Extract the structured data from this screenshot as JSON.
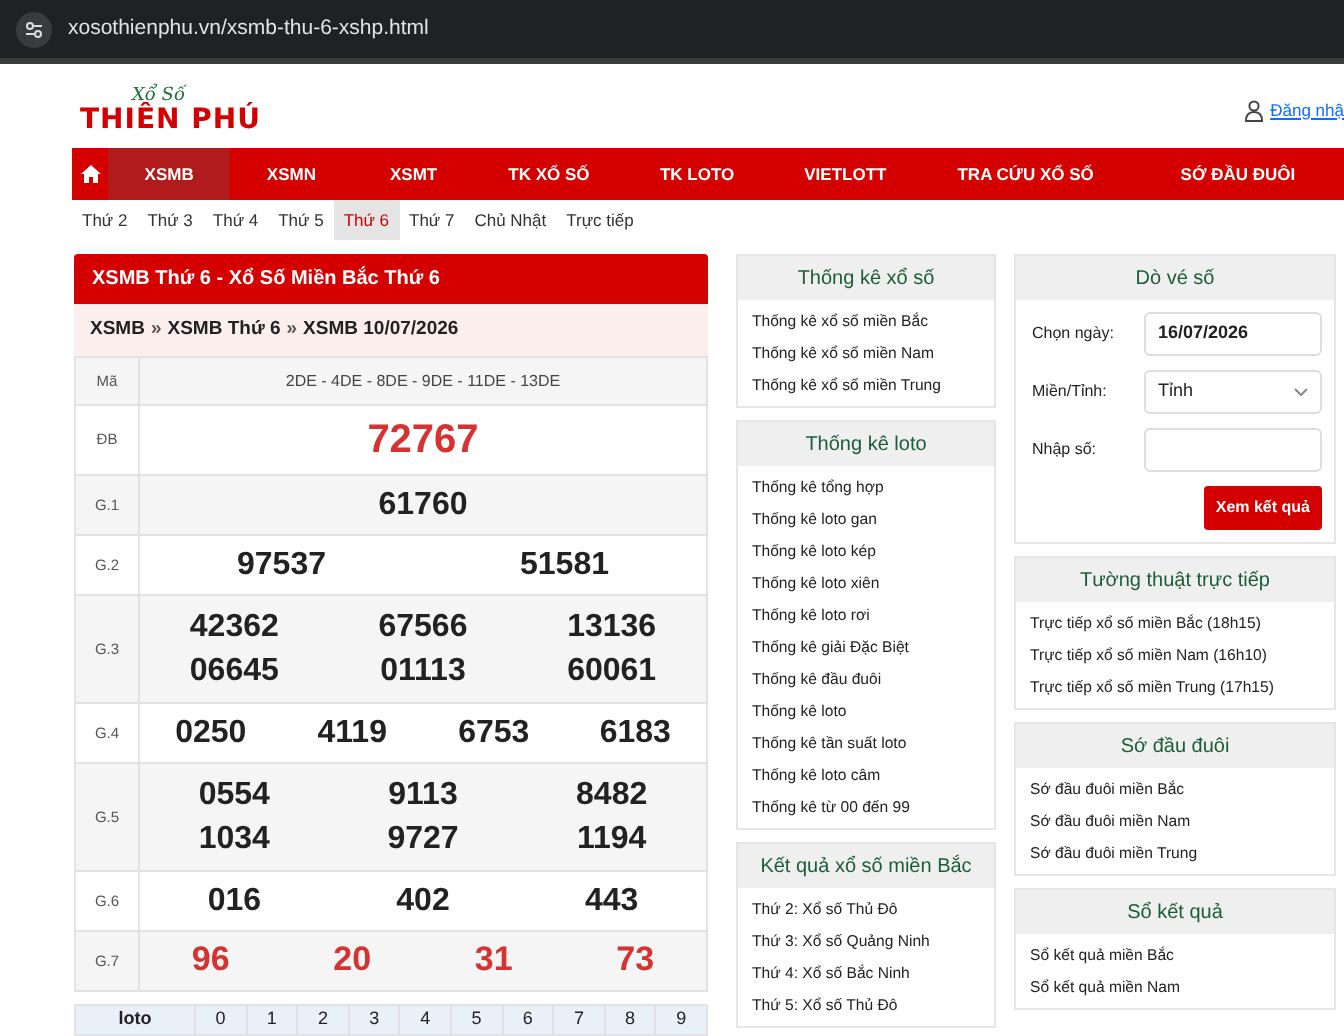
{
  "address_bar": {
    "url": "xosothienphu.vn/xsmb-thu-6-xshp.html"
  },
  "logo": {
    "top": "Xổ Số",
    "main": "THIÊN PHÚ"
  },
  "login": "Đăng nhậ",
  "nav": [
    {
      "label": "XSMB",
      "selected": true
    },
    {
      "label": "XSMN",
      "selected": false
    },
    {
      "label": "XSMT",
      "selected": false
    },
    {
      "label": "TK XỔ SỐ",
      "selected": false
    },
    {
      "label": "TK LOTO",
      "selected": false
    },
    {
      "label": "VIETLOTT",
      "selected": false
    },
    {
      "label": "TRA CỨU XỔ SỐ",
      "selected": false
    },
    {
      "label": "SỚ ĐẦU ĐUÔI",
      "selected": false
    }
  ],
  "day_tabs": [
    {
      "label": "Thứ 2",
      "selected": false
    },
    {
      "label": "Thứ 3",
      "selected": false
    },
    {
      "label": "Thứ 4",
      "selected": false
    },
    {
      "label": "Thứ 5",
      "selected": false
    },
    {
      "label": "Thứ 6",
      "selected": true
    },
    {
      "label": "Thứ 7",
      "selected": false
    },
    {
      "label": "Chủ Nhật",
      "selected": false
    },
    {
      "label": "Trực tiếp",
      "selected": false
    }
  ],
  "results": {
    "title": "XSMB Thứ 6 - Xổ Số Miền Bắc Thứ 6",
    "breadcrumb": [
      "XSMB",
      "XSMB Thứ 6",
      "XSMB 10/07/2026"
    ],
    "breadcrumb_separator": "»",
    "code_label": "Mã",
    "code_value": "2DE - 4DE - 8DE - 9DE - 11DE - 13DE",
    "rows": [
      {
        "label": "ĐB",
        "emphasis": true,
        "numbers": [
          "72767"
        ]
      },
      {
        "label": "G.1",
        "emphasis": false,
        "numbers": [
          "61760"
        ]
      },
      {
        "label": "G.2",
        "emphasis": false,
        "numbers": [
          "97537",
          "51581"
        ]
      },
      {
        "label": "G.3",
        "emphasis": false,
        "numbers": [
          "42362",
          "67566",
          "13136",
          "06645",
          "01113",
          "60061"
        ]
      },
      {
        "label": "G.4",
        "emphasis": false,
        "numbers": [
          "0250",
          "4119",
          "6753",
          "6183"
        ]
      },
      {
        "label": "G.5",
        "emphasis": false,
        "numbers": [
          "0554",
          "9113",
          "8482",
          "1034",
          "9727",
          "1194"
        ]
      },
      {
        "label": "G.6",
        "emphasis": false,
        "numbers": [
          "016",
          "402",
          "443"
        ]
      },
      {
        "label": "G.7",
        "emphasis": true,
        "numbers": [
          "96",
          "20",
          "31",
          "73"
        ]
      }
    ],
    "loto_header": [
      "loto",
      "0",
      "1",
      "2",
      "3",
      "4",
      "5",
      "6",
      "7",
      "8",
      "9"
    ]
  },
  "sidebar_left": [
    {
      "title": "Thống kê xổ số",
      "items": [
        "Thống kê xổ số miền Bắc",
        "Thống kê xổ số miền Nam",
        "Thống kê xổ số miền Trung"
      ]
    },
    {
      "title": "Thống kê loto",
      "items": [
        "Thống kê tổng hợp",
        "Thống kê loto gan",
        "Thống kê loto kép",
        "Thống kê loto xiên",
        "Thống kê loto rơi",
        "Thống kê giải Đặc Biệt",
        "Thống kê đầu đuôi",
        "Thống kê loto",
        "Thống kê tần suất loto",
        "Thống kê loto câm",
        "Thống kê từ 00 đến 99"
      ]
    },
    {
      "title": "Kết quả xổ số miền Bắc",
      "items": [
        "Thứ 2: Xổ số Thủ Đô",
        "Thứ 3: Xổ số Quảng Ninh",
        "Thứ 4: Xổ số Bắc Ninh",
        "Thứ 5: Xổ số Thủ Đô"
      ]
    }
  ],
  "ticket_check": {
    "title": "Dò vé số",
    "date_label": "Chọn ngày:",
    "date_value": "16/07/2026",
    "region_label": "Miền/Tỉnh:",
    "region_value": "Tỉnh",
    "number_label": "Nhập số:",
    "button": "Xem kết quả"
  },
  "sidebar_right": [
    {
      "title": "Tường thuật trực tiếp",
      "items": [
        "Trực tiếp xổ số miền Bắc (18h15)",
        "Trực tiếp xổ số miền Nam (16h10)",
        "Trực tiếp xổ số miền Trung (17h15)"
      ]
    },
    {
      "title": "Sớ đầu đuôi",
      "items": [
        "Sớ đầu đuôi miền Bắc",
        "Sớ đầu đuôi miền Nam",
        "Sớ đầu đuôi miền Trung"
      ]
    },
    {
      "title": "Sổ kết quả",
      "items": [
        "Sổ kết quả miền Bắc",
        "Sổ kết quả miền Nam"
      ]
    }
  ]
}
